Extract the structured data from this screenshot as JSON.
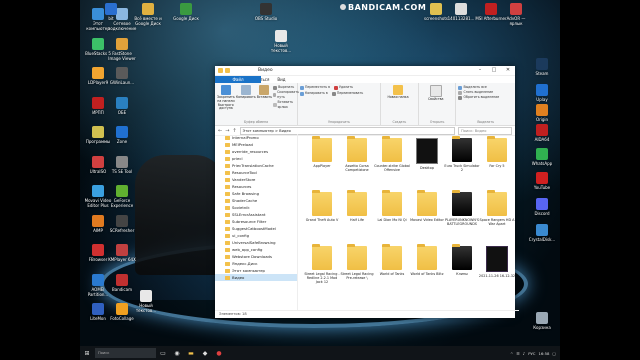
{
  "recorder": {
    "brand": "BANDICAM",
    "domain": ".COM"
  },
  "desktop_icons_left": [
    {
      "label": "Этот компьютер",
      "color": "#3a8fd9"
    },
    {
      "label": "Сетевое подключение",
      "color": "#8bb7e0"
    },
    {
      "label": "BlueStacks 5",
      "color": "#3cc068"
    },
    {
      "label": "FastStone Image Viewer",
      "color": "#e0a13a"
    },
    {
      "label": "LDPlayer9",
      "color": "#f2a530"
    },
    {
      "label": "GWinLaun...",
      "color": "#5a5a5a"
    },
    {
      "label": "ИРПП",
      "color": "#c02020"
    },
    {
      "label": "ОБЕ",
      "color": "#2a80c0"
    },
    {
      "label": "Программы",
      "color": "#d0c050"
    },
    {
      "label": "Zone",
      "color": "#2070d0"
    },
    {
      "label": "UltraISO",
      "color": "#d04040"
    },
    {
      "label": "TS SE Tool",
      "color": "#888888"
    },
    {
      "label": "Movavi Video Editor Plus",
      "color": "#3aa0e0"
    },
    {
      "label": "GeForce Experience",
      "color": "#60b030"
    },
    {
      "label": "AIMP",
      "color": "#e07a20"
    },
    {
      "label": "SCRefresher",
      "color": "#444444"
    },
    {
      "label": "FBrowser",
      "color": "#d03030"
    },
    {
      "label": "KMPlayer 64X",
      "color": "#c04040"
    },
    {
      "label": "AOMEI Partition...",
      "color": "#2a7ad0"
    },
    {
      "label": "Bandicam",
      "color": "#c03030"
    },
    {
      "label": "LiteMon",
      "color": "#3060c0"
    },
    {
      "label": "FotoCollage",
      "color": "#f0a020"
    }
  ],
  "desktop_icons_top": [
    {
      "label": "bit",
      "color": "#2a6fd0"
    },
    {
      "label": "Всё вместе и Google Диск",
      "color": "#e0b040"
    },
    {
      "label": "Google Диск",
      "color": "#3a9a40"
    },
    {
      "label": "OBS Studio",
      "color": "#333333"
    },
    {
      "label": "Новый текстов...",
      "color": "#e8e8e8"
    },
    {
      "label": "screenshots",
      "color": "#e0c050"
    },
    {
      "label": "140113281...",
      "color": "#dddddd"
    },
    {
      "label": "MSI Afterburner",
      "color": "#c02020"
    },
    {
      "label": "AdvOR — ярлык",
      "color": "#d04040"
    }
  ],
  "desktop_icons_right": [
    {
      "label": "Steam",
      "color": "#1b3a5c"
    },
    {
      "label": "Uplay",
      "color": "#2070d0"
    },
    {
      "label": "Origin",
      "color": "#e08020"
    },
    {
      "label": "AIDA64",
      "color": "#c02020"
    },
    {
      "label": "WhatsApp",
      "color": "#30b050"
    },
    {
      "label": "YouTube",
      "color": "#d02020"
    },
    {
      "label": "Discord",
      "color": "#5865f2"
    },
    {
      "label": "CrystalDisk...",
      "color": "#3a8ad0"
    },
    {
      "label": "Корзина",
      "color": "#9aa8b4"
    }
  ],
  "desktop_icons_bottom": [
    {
      "label": "Новый текстов...",
      "color": "#e8e8e8"
    }
  ],
  "window": {
    "title": "Видео",
    "tabs": [
      "Файл",
      "Главная",
      "Поделиться",
      "Вид"
    ],
    "ribbon": {
      "clipboard": {
        "name": "Буфер обмена",
        "pin": "Закрепить на панели быстрого доступа",
        "copy": "Копировать",
        "paste": "Вставить",
        "cut": "Вырезать",
        "copy_path": "Скопировать путь",
        "paste_shortcut": "Вставить ярлык"
      },
      "organize": {
        "name": "Упорядочить",
        "move": "Переместить в",
        "copy_to": "Копировать в",
        "delete": "Удалить",
        "rename": "Переименовать"
      },
      "new": {
        "name": "Создать",
        "new_folder": "Новая папка"
      },
      "open": {
        "name": "Открыть",
        "properties": "Свойства"
      },
      "select": {
        "name": "Выделить",
        "select_all": "Выделить все",
        "select_none": "Снять выделение",
        "invert": "Обратить выделение"
      }
    },
    "address": {
      "path": "Этот компьютер  >  Видео",
      "search_placeholder": "Поиск: Видео"
    },
    "sidebar": [
      {
        "label": "InternalPromo",
        "sel": false
      },
      {
        "label": "MEIPreload",
        "sel": false
      },
      {
        "label": "override_resources",
        "sel": false
      },
      {
        "label": "priecl",
        "sel": false
      },
      {
        "label": "PriecTranslationCache",
        "sel": false
      },
      {
        "label": "ResourceTool",
        "sel": false
      },
      {
        "label": "VanderStore",
        "sel": false
      },
      {
        "label": "Resources",
        "sel": false
      },
      {
        "label": "Safe Browsing",
        "sel": false
      },
      {
        "label": "ShaderCache",
        "sel": false
      },
      {
        "label": "Sovietnik",
        "sel": false
      },
      {
        "label": "SSLErrorAssistant",
        "sel": false
      },
      {
        "label": "Subresource Filter",
        "sel": false
      },
      {
        "label": "SuggestCatboostModel",
        "sel": false
      },
      {
        "label": "ui_config",
        "sel": false
      },
      {
        "label": "UniversalSafeBrowsing",
        "sel": false
      },
      {
        "label": "web_app_config",
        "sel": false
      },
      {
        "label": "Webstore Downloads",
        "sel": false
      },
      {
        "label": "Яндекс.Диск",
        "sel": false
      },
      {
        "label": "Этот компьютер",
        "sel": false
      },
      {
        "label": "Видео",
        "sel": true
      }
    ],
    "files": [
      {
        "label": "AppPlayer",
        "kind": "folder"
      },
      {
        "label": "Assetto Corsa Competizione",
        "kind": "folder"
      },
      {
        "label": "Counter-strike Global Offensive",
        "kind": "folder"
      },
      {
        "label": "Desktop",
        "kind": "dark"
      },
      {
        "label": "Euro Truck Simulator 2",
        "kind": "darkthumb"
      },
      {
        "label": "Far Cry 5",
        "kind": "folder"
      },
      {
        "label": "Grand Theft Auto V",
        "kind": "folder"
      },
      {
        "label": "Half Life",
        "kind": "folder"
      },
      {
        "label": "Lai Dian Mo Ni Qi",
        "kind": "folder"
      },
      {
        "label": "Movavi Video Editor",
        "kind": "folder"
      },
      {
        "label": "PLAYERUNKNOWN'S BATTLEGROUNDS",
        "kind": "darkthumb"
      },
      {
        "label": "Space Rangers HD  A War Apart",
        "kind": "folder"
      },
      {
        "label": "Street Legal Racing - Redline 2.2.1 Mod Jack 12",
        "kind": "folder"
      },
      {
        "label": "Street Legal Racing Pre-release \\",
        "kind": "folder"
      },
      {
        "label": "World of Tanks",
        "kind": "folder"
      },
      {
        "label": "World of Tanks Blitz",
        "kind": "folder"
      },
      {
        "label": "Клипы",
        "kind": "darkthumb"
      },
      {
        "label": "2021-11-26 16-12-32",
        "kind": "video"
      }
    ],
    "status": "Элементов: 18"
  },
  "taskbar": {
    "search_placeholder": "Поиск",
    "lang": "РУС",
    "time": "16:58"
  }
}
